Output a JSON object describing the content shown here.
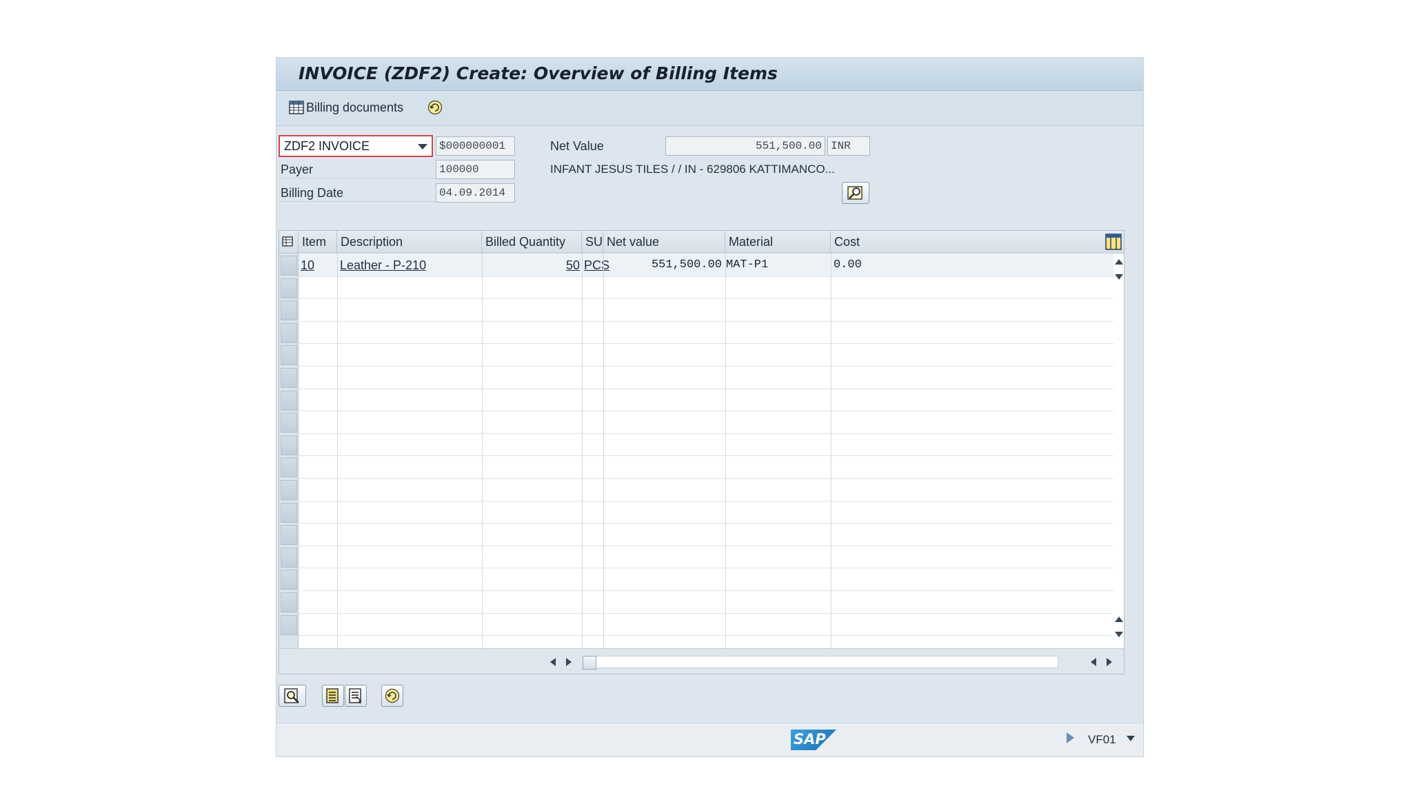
{
  "window": {
    "title": "INVOICE  (ZDF2) Create: Overview of Billing Items"
  },
  "toolbar": {
    "billing_documents_label": "Billing documents"
  },
  "header": {
    "billing_type": "ZDF2 INVOICE",
    "document_number": "$000000001",
    "net_value_label": "Net Value",
    "net_value": "551,500.00",
    "currency": "INR",
    "payer_label": "Payer",
    "payer": "100000",
    "payer_name": "INFANT JESUS TILES /  / IN - 629806 KATTIMANCO...",
    "billing_date_label": "Billing Date",
    "billing_date": "04.09.2014"
  },
  "table": {
    "columns": [
      "Item",
      "Description",
      "Billed Quantity",
      "SU",
      "Net value",
      "Material",
      "Cost"
    ],
    "rows": [
      {
        "item": "10",
        "description": "Leather - P-210",
        "billed_quantity": "50",
        "su": "PCS",
        "net_value": "551,500.00",
        "material": "MAT-P1",
        "cost": "0.00"
      }
    ]
  },
  "status": {
    "transaction_code": "VF01",
    "logo_text": "SAP"
  }
}
